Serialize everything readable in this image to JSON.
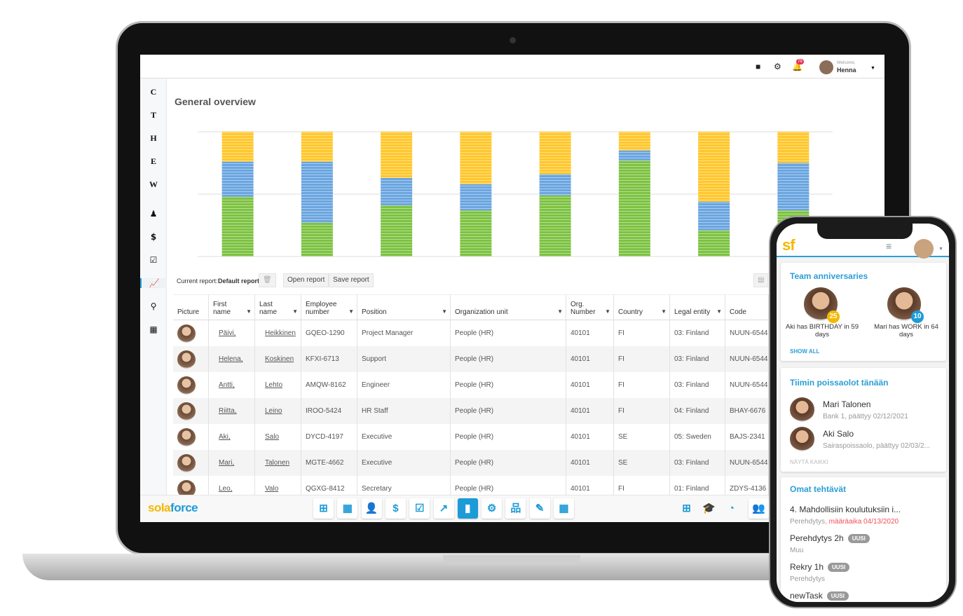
{
  "topbar": {
    "welcome": "Welcome,",
    "user": "Henna",
    "notifications": "79",
    "icons": [
      "video-camera-icon",
      "gear-icon",
      "bell-icon",
      "chevron-down-icon"
    ]
  },
  "sidebar": {
    "letters": [
      "C",
      "T",
      "H",
      "E",
      "W"
    ],
    "icons": [
      {
        "name": "user-icon",
        "glyph": "♟"
      },
      {
        "name": "dollar-icon",
        "glyph": "$"
      },
      {
        "name": "checkbox-icon",
        "glyph": "☑"
      },
      {
        "name": "line-chart-icon",
        "glyph": "📈"
      },
      {
        "name": "org-chart-icon",
        "glyph": "⚲"
      },
      {
        "name": "calendar-icon",
        "glyph": "▦"
      }
    ],
    "active": "line-chart-icon"
  },
  "page_title": "General overview",
  "chart_data": {
    "type": "bar",
    "stacked": true,
    "grid": true,
    "ylim": [
      0,
      100
    ],
    "colors": {
      "green": "#7dc242",
      "blue": "#6aa5e0",
      "yellow": "#ffc72c"
    },
    "series": [
      {
        "color": "green",
        "values": [
          48,
          27,
          41,
          37,
          49,
          77,
          21,
          37
        ]
      },
      {
        "color": "blue",
        "values": [
          28,
          49,
          22,
          21,
          17,
          8,
          23,
          38
        ]
      },
      {
        "color": "yellow",
        "values": [
          24,
          24,
          37,
          42,
          34,
          15,
          56,
          25
        ]
      }
    ]
  },
  "report": {
    "current_label": "Current report:",
    "current_value": "Default report",
    "open": "Open report",
    "save": "Save report"
  },
  "table": {
    "columns": [
      "Picture",
      "First name",
      "Last name",
      "Employee number",
      "Position",
      "Organization unit",
      "Org. Number",
      "Country",
      "Legal entity",
      "Code"
    ],
    "rows": [
      [
        "",
        "Päivi,",
        "Heikkinen",
        "GQEO-1290",
        "Project Manager",
        "People (HR)",
        "40101",
        "FI",
        "03: Finland",
        "NUUN-6544"
      ],
      [
        "",
        "Helena,",
        "Koskinen",
        "KFXI-6713",
        "Support",
        "People (HR)",
        "40101",
        "FI",
        "03: Finland",
        "NUUN-6544"
      ],
      [
        "",
        "Antti,",
        "Lehto",
        "AMQW-8162",
        "Engineer",
        "People (HR)",
        "40101",
        "FI",
        "03: Finland",
        "NUUN-6544"
      ],
      [
        "",
        "Riitta,",
        "Leino",
        "IROO-5424",
        "HR Staff",
        "People (HR)",
        "40101",
        "FI",
        "04: Finland",
        "BHAY-6676"
      ],
      [
        "",
        "Aki,",
        "Salo",
        "DYCD-4197",
        "Executive",
        "People (HR)",
        "40101",
        "SE",
        "05: Sweden",
        "BAJS-2341"
      ],
      [
        "",
        "Mari,",
        "Talonen",
        "MGTE-4662",
        "Executive",
        "People (HR)",
        "40101",
        "SE",
        "03: Finland",
        "NUUN-6544"
      ],
      [
        "",
        "Leo,",
        "Valo",
        "QGXG-8412",
        "Secretary",
        "People (HR)",
        "40101",
        "FI",
        "01: Finland",
        "ZDYS-4136"
      ]
    ]
  },
  "bottombar": {
    "logo_a": "sola",
    "logo_b": "force",
    "apps": [
      {
        "name": "dashboard-add-icon",
        "glyph": "⊞"
      },
      {
        "name": "grid-icon",
        "glyph": "▦"
      },
      {
        "name": "user-icon",
        "glyph": "👤"
      },
      {
        "name": "dollar-icon",
        "glyph": "$"
      },
      {
        "name": "checkbox-icon",
        "glyph": "☑"
      },
      {
        "name": "line-chart-icon",
        "glyph": "↗"
      },
      {
        "name": "bar-chart-icon",
        "glyph": "▮"
      },
      {
        "name": "gears-icon",
        "glyph": "⚙"
      },
      {
        "name": "org-chart-icon",
        "glyph": "品"
      },
      {
        "name": "edit-icon",
        "glyph": "✎"
      },
      {
        "name": "calendar-icon",
        "glyph": "▦"
      }
    ],
    "active": "bar-chart-icon",
    "right_icons": [
      {
        "name": "dashboard-add-icon",
        "glyph": "⊞"
      },
      {
        "name": "graduation-cap-icon",
        "glyph": "🎓"
      },
      {
        "name": "gauge-icon",
        "glyph": "◔"
      },
      {
        "name": "team-icon",
        "glyph": "👥"
      }
    ]
  },
  "phone": {
    "logo": "sf",
    "anniversaries": {
      "title": "Team anniversaries",
      "people": [
        {
          "text": "Aki has BIRTHDAY in 59 days",
          "badge": "25",
          "badge_color": "#f5b800"
        },
        {
          "text": "Mari has WORK in 64 days",
          "badge": "10",
          "badge_color": "#1d9bd7"
        }
      ],
      "show_all": "SHOW ALL"
    },
    "absences": {
      "title": "Tiimin poissaolot tänään",
      "people": [
        {
          "name": "Mari Talonen",
          "detail": "Bank 1, päättyy 02/12/2021"
        },
        {
          "name": "Aki Salo",
          "detail": "Sairaspoissaolo, päättyy 02/03/2..."
        }
      ],
      "show_all": "NÄYTÄ KAIKKI"
    },
    "tasks": {
      "title": "Omat tehtävät",
      "items": [
        {
          "title": "4. Mahdollisiin koulutuksiin i...",
          "sub": "Perehdytys,",
          "due": "määräaika 04/13/2020"
        },
        {
          "title": "Perehdytys 2h",
          "badge": "UUSI",
          "sub": "Muu"
        },
        {
          "title": "Rekry 1h",
          "badge": "UUSI",
          "sub": "Perehdytys"
        },
        {
          "title": "newTask",
          "badge": "UUSI"
        }
      ]
    }
  }
}
